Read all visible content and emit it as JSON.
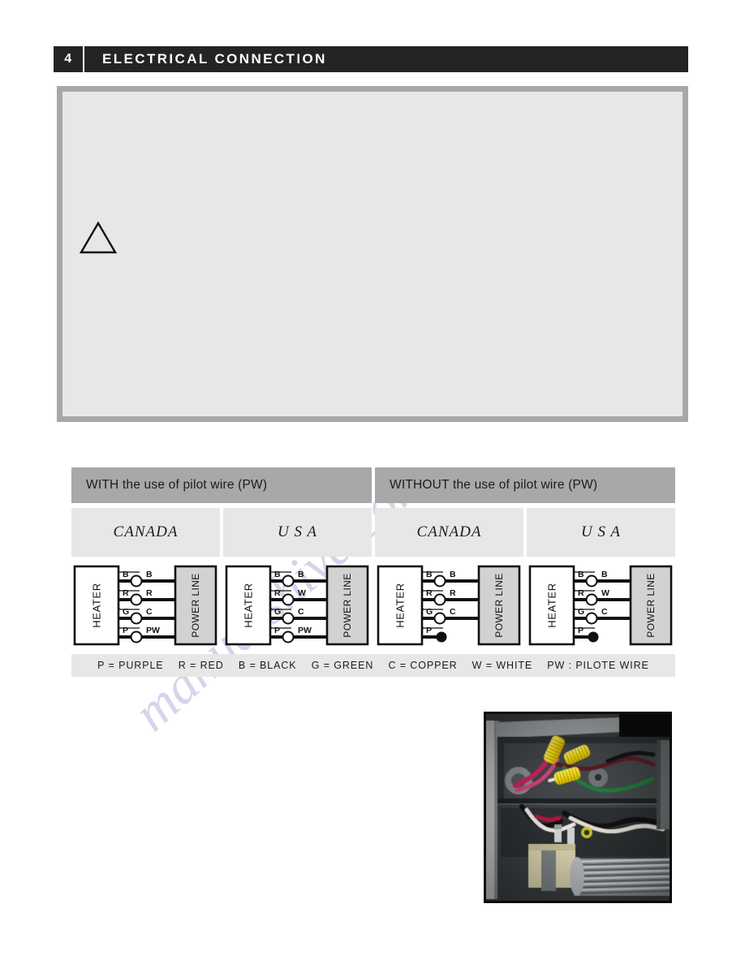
{
  "page": {
    "section_number": "4",
    "section_title": "ELECTRICAL CONNECTION"
  },
  "warning": {
    "icon": "warning-triangle-icon",
    "body": ""
  },
  "wiring_table": {
    "headers": [
      {
        "id": "with-pw",
        "label": "WITH the use of pilot wire (PW)"
      },
      {
        "id": "without-pw",
        "label": "WITHOUT the use of pilot wire (PW)"
      }
    ],
    "countries": [
      {
        "id": "with-canada",
        "label": "CANADA"
      },
      {
        "id": "with-usa",
        "label": "U S A"
      },
      {
        "id": "without-canada",
        "label": "CANADA"
      },
      {
        "id": "without-usa",
        "label": "U S A"
      }
    ],
    "diagrams": [
      {
        "id": "diagram-with-canada",
        "left_box_label": "HEATER",
        "right_box_label": "POWER LINE",
        "connections": [
          {
            "left": "B",
            "right": "B",
            "type": "open"
          },
          {
            "left": "R",
            "right": "R",
            "type": "open"
          },
          {
            "left": "G",
            "right": "C",
            "type": "open"
          },
          {
            "left": "P",
            "right": "PW",
            "type": "open"
          }
        ]
      },
      {
        "id": "diagram-with-usa",
        "left_box_label": "HEATER",
        "right_box_label": "POWER LINE",
        "connections": [
          {
            "left": "B",
            "right": "B",
            "type": "open"
          },
          {
            "left": "R",
            "right": "W",
            "type": "open"
          },
          {
            "left": "G",
            "right": "C",
            "type": "open"
          },
          {
            "left": "P",
            "right": "PW",
            "type": "open"
          }
        ]
      },
      {
        "id": "diagram-without-canada",
        "left_box_label": "HEATER",
        "right_box_label": "POWER LINE",
        "connections": [
          {
            "left": "B",
            "right": "B",
            "type": "open"
          },
          {
            "left": "R",
            "right": "R",
            "type": "open"
          },
          {
            "left": "G",
            "right": "C",
            "type": "open"
          },
          {
            "left": "P",
            "right": "",
            "type": "capped"
          }
        ]
      },
      {
        "id": "diagram-without-usa",
        "left_box_label": "HEATER",
        "right_box_label": "POWER LINE",
        "connections": [
          {
            "left": "B",
            "right": "B",
            "type": "open"
          },
          {
            "left": "R",
            "right": "W",
            "type": "open"
          },
          {
            "left": "G",
            "right": "C",
            "type": "open"
          },
          {
            "left": "P",
            "right": "",
            "type": "capped"
          }
        ]
      }
    ],
    "legend": [
      "P = PURPLE",
      "R = RED",
      "B = BLACK",
      "G = GREEN",
      "C = COPPER",
      "W = WHITE",
      "PW : PILOTE WIRE"
    ]
  },
  "photo": {
    "id": "wiring-photo",
    "alt": "Junction box interior with yellow wire nuts and blower"
  },
  "watermark": {
    "line1": "manualshive.com"
  },
  "colors": {
    "header_bar": "#242424",
    "box_border": "#a8a8a8",
    "box_fill": "#e7e7e7",
    "cell_fill": "#e7e7e7",
    "header_cell_fill": "#a8a8a8",
    "text": "#1c1c1c",
    "watermark": "#9a9ad0"
  }
}
